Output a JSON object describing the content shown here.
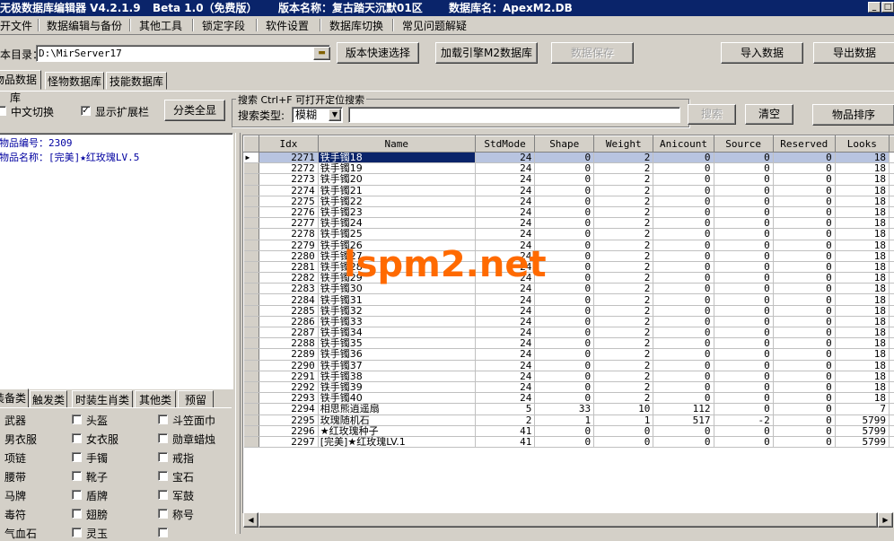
{
  "titlebar": {
    "app_title": "无极数据库编辑器 V4.2.1.9",
    "beta": "Beta 1.0（免费版）",
    "version_name": "版本名称：复古踏天沉默01区",
    "db_name": "数据库名：ApexM2.DB",
    "min": "_",
    "max": "□"
  },
  "menu": [
    "开文件",
    "数据编辑与备份",
    "其他工具",
    "锁定字段",
    "软件设置",
    "数据库切换",
    "常见问题解疑"
  ],
  "toolbar": {
    "dir_label": "本目录：",
    "dir_value": "D:\\MirServer17",
    "quick_select": "版本快速选择",
    "load_m2": "加载引擎M2数据库",
    "save_data": "数据保存",
    "import": "导入数据",
    "export": "导出数据"
  },
  "tabs": [
    "物品数据库",
    "怪物数据库",
    "技能数据库"
  ],
  "options": {
    "chinese_toggle": "中文切换",
    "show_ext": "显示扩展栏",
    "category_all": "分类全显"
  },
  "search": {
    "group_label": "搜索  Ctrl+F 可打开定位搜索",
    "type_label": "搜索类型:",
    "type_value": "模糊",
    "search_btn": "搜索",
    "clear_btn": "清空",
    "sort_btn": "物品排序"
  },
  "info": {
    "item_id": "物品编号：2309",
    "item_name": "物品名称：[完美]★红玫瑰LV.5"
  },
  "category_tabs": [
    "装备类",
    "触发类",
    "时装生肖类",
    "其他类",
    "预留"
  ],
  "categories": [
    [
      "武器",
      "头盔",
      "斗笠面巾"
    ],
    [
      "男衣服",
      "女衣服",
      "勋章蜡烛"
    ],
    [
      "项链",
      "手镯",
      "戒指"
    ],
    [
      "腰带",
      "靴子",
      "宝石"
    ],
    [
      "马牌",
      "盾牌",
      "军鼓"
    ],
    [
      "毒符",
      "翅膀",
      "称号"
    ],
    [
      "气血石",
      "灵玉",
      ""
    ]
  ],
  "table": {
    "columns": [
      "Idx",
      "Name",
      "StdMode",
      "Shape",
      "Weight",
      "Anicount",
      "Source",
      "Reserved",
      "Looks"
    ],
    "rows": [
      [
        "2271",
        "铁手镯18",
        "24",
        "0",
        "2",
        "0",
        "0",
        "0",
        "18"
      ],
      [
        "2272",
        "铁手镯19",
        "24",
        "0",
        "2",
        "0",
        "0",
        "0",
        "18"
      ],
      [
        "2273",
        "铁手镯20",
        "24",
        "0",
        "2",
        "0",
        "0",
        "0",
        "18"
      ],
      [
        "2274",
        "铁手镯21",
        "24",
        "0",
        "2",
        "0",
        "0",
        "0",
        "18"
      ],
      [
        "2275",
        "铁手镯22",
        "24",
        "0",
        "2",
        "0",
        "0",
        "0",
        "18"
      ],
      [
        "2276",
        "铁手镯23",
        "24",
        "0",
        "2",
        "0",
        "0",
        "0",
        "18"
      ],
      [
        "2277",
        "铁手镯24",
        "24",
        "0",
        "2",
        "0",
        "0",
        "0",
        "18"
      ],
      [
        "2278",
        "铁手镯25",
        "24",
        "0",
        "2",
        "0",
        "0",
        "0",
        "18"
      ],
      [
        "2279",
        "铁手镯26",
        "24",
        "0",
        "2",
        "0",
        "0",
        "0",
        "18"
      ],
      [
        "2280",
        "铁手镯27",
        "24",
        "0",
        "2",
        "0",
        "0",
        "0",
        "18"
      ],
      [
        "2281",
        "铁手镯28",
        "24",
        "0",
        "2",
        "0",
        "0",
        "0",
        "18"
      ],
      [
        "2282",
        "铁手镯29",
        "24",
        "0",
        "2",
        "0",
        "0",
        "0",
        "18"
      ],
      [
        "2283",
        "铁手镯30",
        "24",
        "0",
        "2",
        "0",
        "0",
        "0",
        "18"
      ],
      [
        "2284",
        "铁手镯31",
        "24",
        "0",
        "2",
        "0",
        "0",
        "0",
        "18"
      ],
      [
        "2285",
        "铁手镯32",
        "24",
        "0",
        "2",
        "0",
        "0",
        "0",
        "18"
      ],
      [
        "2286",
        "铁手镯33",
        "24",
        "0",
        "2",
        "0",
        "0",
        "0",
        "18"
      ],
      [
        "2287",
        "铁手镯34",
        "24",
        "0",
        "2",
        "0",
        "0",
        "0",
        "18"
      ],
      [
        "2288",
        "铁手镯35",
        "24",
        "0",
        "2",
        "0",
        "0",
        "0",
        "18"
      ],
      [
        "2289",
        "铁手镯36",
        "24",
        "0",
        "2",
        "0",
        "0",
        "0",
        "18"
      ],
      [
        "2290",
        "铁手镯37",
        "24",
        "0",
        "2",
        "0",
        "0",
        "0",
        "18"
      ],
      [
        "2291",
        "铁手镯38",
        "24",
        "0",
        "2",
        "0",
        "0",
        "0",
        "18"
      ],
      [
        "2292",
        "铁手镯39",
        "24",
        "0",
        "2",
        "0",
        "0",
        "0",
        "18"
      ],
      [
        "2293",
        "铁手镯40",
        "24",
        "0",
        "2",
        "0",
        "0",
        "0",
        "18"
      ],
      [
        "2294",
        "相思熊逍遥扇",
        "5",
        "33",
        "10",
        "112",
        "0",
        "0",
        "7"
      ],
      [
        "2295",
        "玫瑰随机石",
        "2",
        "1",
        "1",
        "517",
        "-2",
        "0",
        "5799"
      ],
      [
        "2296",
        "★红玫瑰种子",
        "41",
        "0",
        "0",
        "0",
        "0",
        "0",
        "5799"
      ],
      [
        "2297",
        "[完美]★红玫瑰LV.1",
        "41",
        "0",
        "0",
        "0",
        "0",
        "0",
        "5799"
      ]
    ]
  },
  "watermark": "lspm2.net",
  "colors": {
    "title_bg": "#0a246a",
    "face": "#d4d0c8",
    "selection": "#0a246a",
    "watermark": "#ff6a00"
  }
}
